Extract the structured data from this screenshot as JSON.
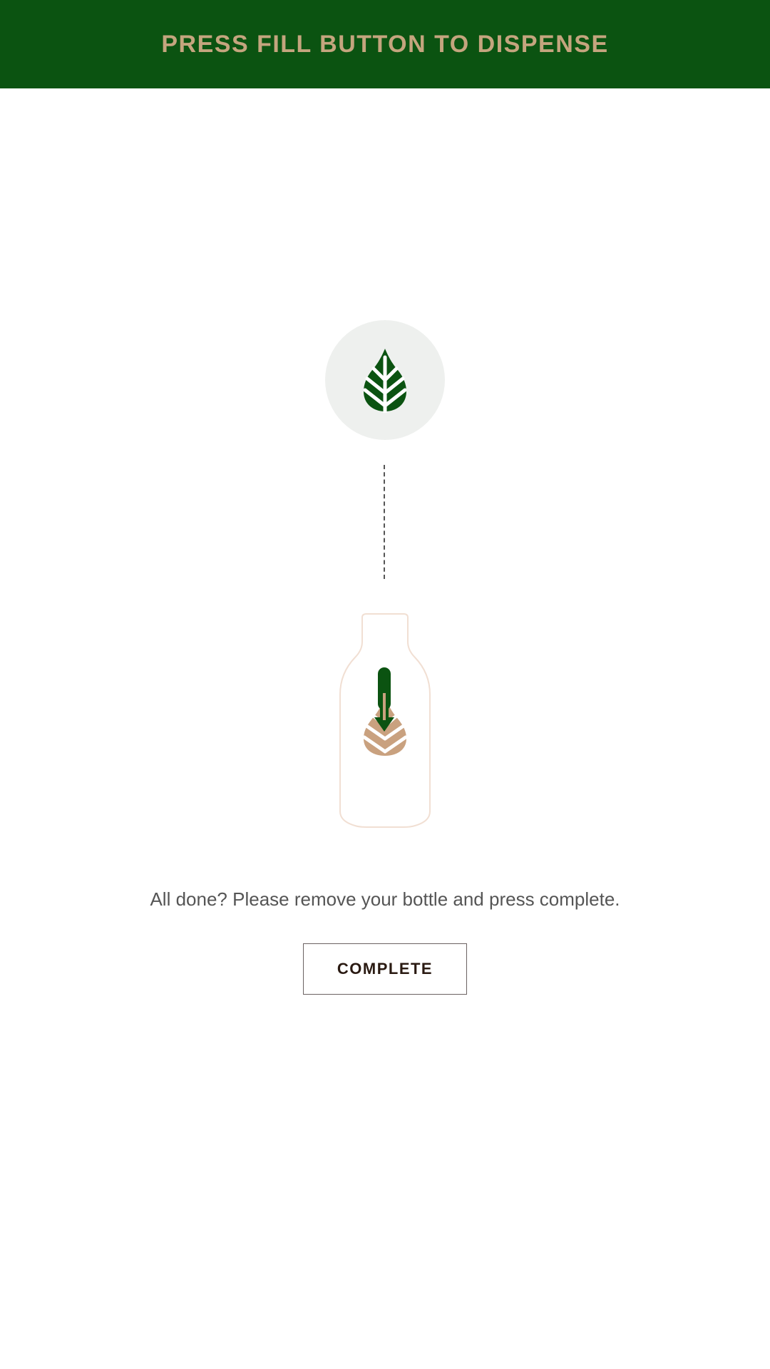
{
  "header": {
    "title": "PRESS FILL BUTTON TO DISPENSE"
  },
  "dispenser": {
    "icon": "leaf-icon"
  },
  "bottle": {
    "icon": "bottle-icon",
    "logo_icon": "leaf-icon",
    "fill_arrow_icon": "down-arrow-icon"
  },
  "instructions": {
    "message": "All done? Please remove your bottle and press complete."
  },
  "actions": {
    "complete_label": "COMPLETE"
  },
  "colors": {
    "header_bg": "#0b5311",
    "header_text": "#c4a57e",
    "leaf_green": "#0b5311",
    "leaf_tan": "#c9a17f",
    "circle_bg": "#eef0ee",
    "bottle_outline": "#f1dfd3"
  }
}
